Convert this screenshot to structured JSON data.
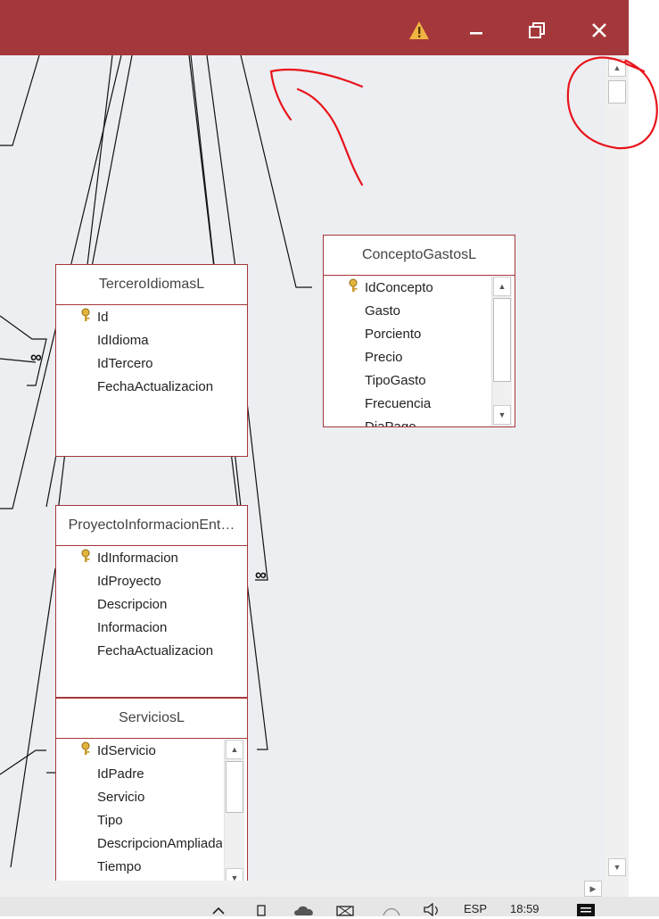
{
  "window": {
    "warning_icon": "warning-icon",
    "minimize_icon": "minimize-icon",
    "restore_icon": "restore-icon",
    "close_icon": "close-icon"
  },
  "tables": {
    "tercero_idiomas": {
      "title": "TerceroIdiomasL",
      "fields": [
        "Id",
        "IdIdioma",
        "IdTercero",
        "FechaActualizacion"
      ]
    },
    "concepto_gastos": {
      "title": "ConceptoGastosL",
      "fields": [
        "IdConcepto",
        "Gasto",
        "Porciento",
        "Precio",
        "TipoGasto",
        "Frecuencia",
        "DiaPago"
      ]
    },
    "proyecto_informacion": {
      "title": "ProyectoInformacionEnt…",
      "fields": [
        "IdInformacion",
        "IdProyecto",
        "Descripcion",
        "Informacion",
        "FechaActualizacion"
      ]
    },
    "servicios": {
      "title": "ServiciosL",
      "fields": [
        "IdServicio",
        "IdPadre",
        "Servicio",
        "Tipo",
        "DescripcionAmpliada",
        "Tiempo"
      ]
    }
  },
  "relationship_marker": "∞",
  "taskbar": {
    "language": "ESP",
    "time": "18:59"
  },
  "annotation_color": "#e8141a"
}
